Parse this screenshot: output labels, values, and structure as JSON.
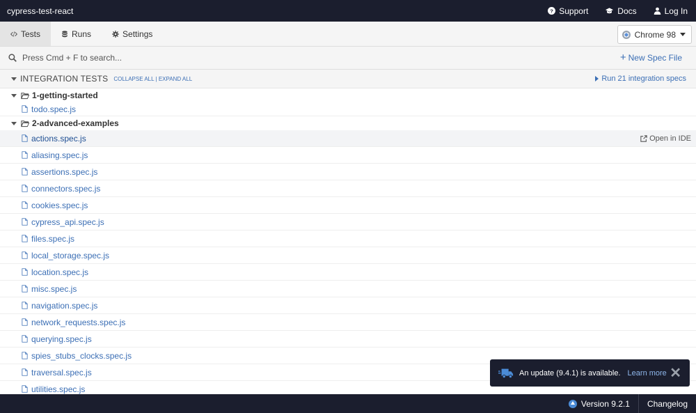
{
  "app": {
    "title": "cypress-test-react"
  },
  "topnav": {
    "support": "Support",
    "docs": "Docs",
    "login": "Log In"
  },
  "tabs": [
    {
      "label": "Tests",
      "active": true
    },
    {
      "label": "Runs",
      "active": false
    },
    {
      "label": "Settings",
      "active": false
    }
  ],
  "browser": {
    "label": "Chrome 98"
  },
  "search": {
    "placeholder": "Press Cmd + F to search...",
    "value": ""
  },
  "new_spec": {
    "label": "New Spec File"
  },
  "section": {
    "title": "INTEGRATION TESTS",
    "collapse_all": "COLLAPSE ALL",
    "separator": "|",
    "expand_all": "EXPAND ALL",
    "run_label": "Run 21 integration specs"
  },
  "folders": [
    {
      "name": "1-getting-started",
      "files": [
        "todo.spec.js"
      ]
    },
    {
      "name": "2-advanced-examples",
      "files": [
        "actions.spec.js",
        "aliasing.spec.js",
        "assertions.spec.js",
        "connectors.spec.js",
        "cookies.spec.js",
        "cypress_api.spec.js",
        "files.spec.js",
        "local_storage.spec.js",
        "location.spec.js",
        "misc.spec.js",
        "navigation.spec.js",
        "network_requests.spec.js",
        "querying.spec.js",
        "spies_stubs_clocks.spec.js",
        "traversal.spec.js",
        "utilities.spec.js"
      ]
    }
  ],
  "hovered_file": {
    "open_in_ide": "Open in IDE"
  },
  "toast": {
    "message": "An update (9.4.1) is available.",
    "learn_more": "Learn more",
    "close": "✕"
  },
  "footer": {
    "version": "Version 9.2.1",
    "changelog": "Changelog"
  },
  "colors": {
    "dark": "#1b1e2e",
    "link": "#3c6fb5",
    "panel": "#f5f5f5"
  }
}
